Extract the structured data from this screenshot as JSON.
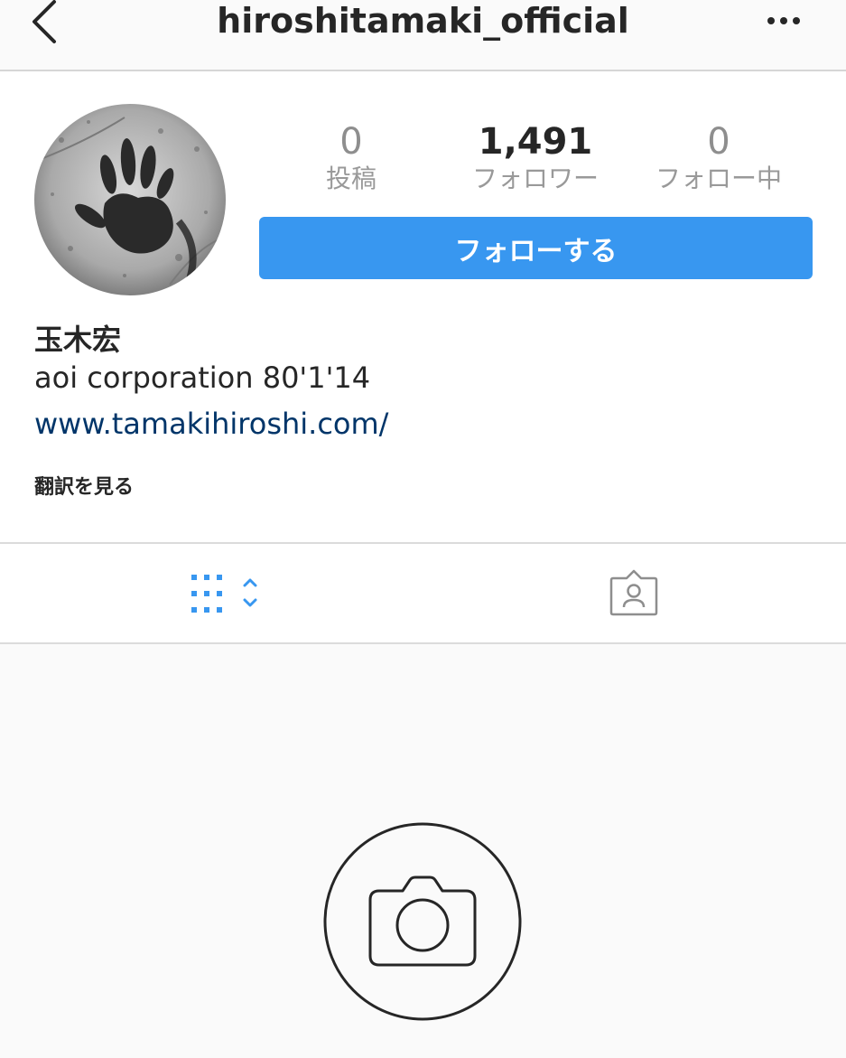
{
  "header": {
    "username": "hiroshitamaki_official",
    "back_icon": "chevron-left-icon",
    "more_icon": "ellipsis-icon"
  },
  "profile": {
    "avatar_icon": "handprint-avatar",
    "stats": [
      {
        "value": "0",
        "label": "投稿"
      },
      {
        "value": "1,491",
        "label": "フォロワー"
      },
      {
        "value": "0",
        "label": "フォロー中"
      }
    ],
    "follow_button": "フォローする",
    "name": "玉木宏",
    "bio": "aoi corporation 80'1'14",
    "website": "www.tamakihiroshi.com/",
    "translate_link": "翻訳を見る"
  },
  "tabs": {
    "grid_icon": "grid-icon",
    "tagged_icon": "tagged-person-icon"
  },
  "empty_state": {
    "icon": "camera-icon"
  },
  "colors": {
    "accent": "#3897f0",
    "link": "#003569"
  }
}
